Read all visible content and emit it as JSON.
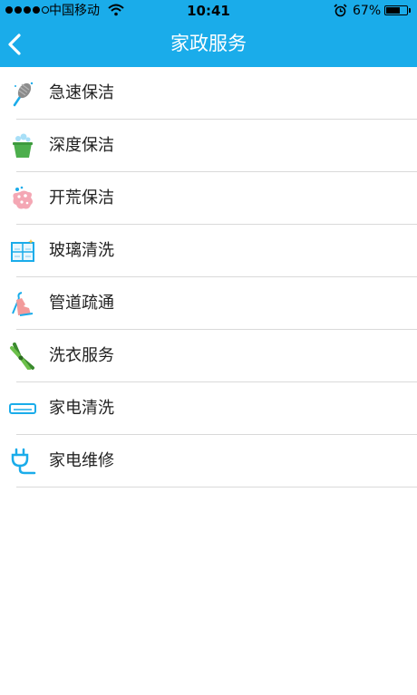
{
  "status_bar": {
    "carrier": "中国移动",
    "time": "10:41",
    "battery_percent": "67%",
    "battery_level": 0.67,
    "signal_strength_dots": 4,
    "icons": [
      "signal-dots-icon",
      "wifi-icon",
      "alarm-clock-icon",
      "battery-icon"
    ]
  },
  "nav": {
    "title": "家政服务",
    "back_icon": "chevron-left-icon",
    "background_color": "#1AACEA"
  },
  "services": [
    {
      "label": "急速保洁",
      "icon": "feather-duster-icon"
    },
    {
      "label": "深度保洁",
      "icon": "bucket-icon"
    },
    {
      "label": "开荒保洁",
      "icon": "sponge-icon"
    },
    {
      "label": "玻璃清洗",
      "icon": "window-icon"
    },
    {
      "label": "管道疏通",
      "icon": "glove-hook-icon"
    },
    {
      "label": "洗衣服务",
      "icon": "clothespin-icon"
    },
    {
      "label": "家电清洗",
      "icon": "air-conditioner-icon"
    },
    {
      "label": "家电维修",
      "icon": "plug-icon"
    }
  ]
}
